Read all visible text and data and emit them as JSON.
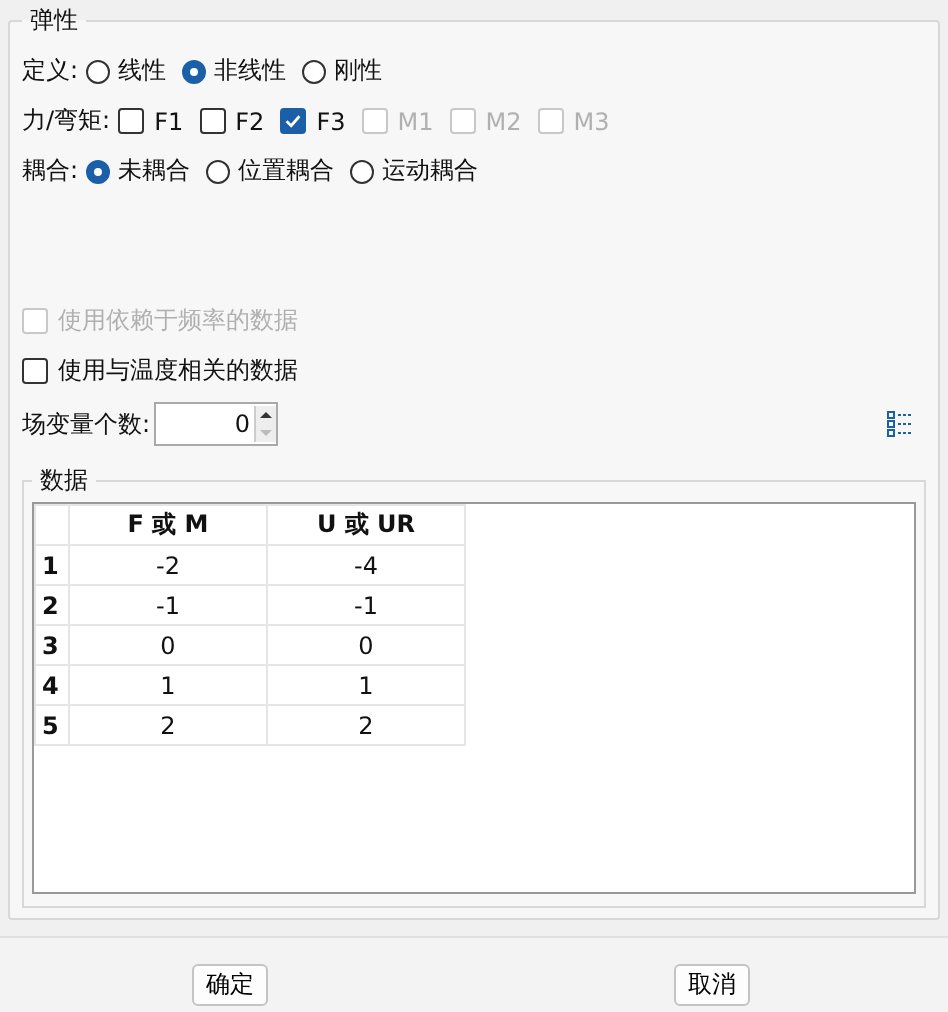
{
  "group": {
    "title": "弹性"
  },
  "definition": {
    "label": "定义:",
    "options": [
      {
        "label": "线性",
        "selected": false
      },
      {
        "label": "非线性",
        "selected": true
      },
      {
        "label": "刚性",
        "selected": false
      }
    ]
  },
  "force_moment": {
    "label": "力/弯矩:",
    "options": [
      {
        "label": "F1",
        "checked": false,
        "disabled": false
      },
      {
        "label": "F2",
        "checked": false,
        "disabled": false
      },
      {
        "label": "F3",
        "checked": true,
        "disabled": false
      },
      {
        "label": "M1",
        "checked": false,
        "disabled": true
      },
      {
        "label": "M2",
        "checked": false,
        "disabled": true
      },
      {
        "label": "M3",
        "checked": false,
        "disabled": true
      }
    ]
  },
  "coupling": {
    "label": "耦合:",
    "options": [
      {
        "label": "未耦合",
        "selected": true
      },
      {
        "label": "位置耦合",
        "selected": false
      },
      {
        "label": "运动耦合",
        "selected": false
      }
    ]
  },
  "options": [
    {
      "label": "使用依赖于频率的数据",
      "checked": false,
      "disabled": true
    },
    {
      "label": "使用与温度相关的数据",
      "checked": false,
      "disabled": false
    }
  ],
  "field_variables": {
    "label": "场变量个数:",
    "value": "0"
  },
  "data": {
    "title": "数据",
    "columns": [
      "F 或 M",
      "U 或 UR"
    ],
    "rows": [
      {
        "index": "1",
        "cells": [
          "-2",
          "-4"
        ]
      },
      {
        "index": "2",
        "cells": [
          "-1",
          "-1"
        ]
      },
      {
        "index": "3",
        "cells": [
          "0",
          "0"
        ]
      },
      {
        "index": "4",
        "cells": [
          "1",
          "1"
        ]
      },
      {
        "index": "5",
        "cells": [
          "2",
          "2"
        ]
      }
    ]
  },
  "buttons": [
    "确定",
    "取消"
  ]
}
